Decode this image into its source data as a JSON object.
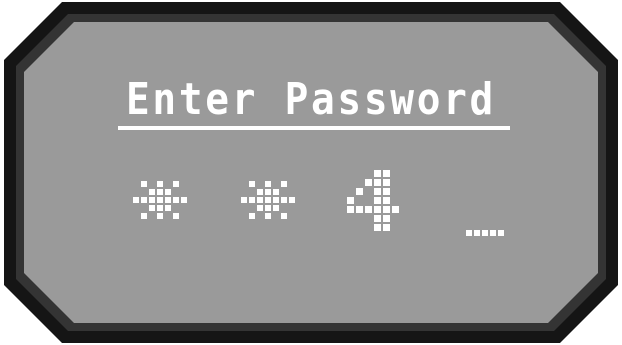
{
  "display": {
    "title": "Enter Password",
    "password_slots": [
      {
        "kind": "mask",
        "char": "*"
      },
      {
        "kind": "mask",
        "char": "*"
      },
      {
        "kind": "digit",
        "char": "4"
      },
      {
        "kind": "cursor",
        "char": "_"
      }
    ]
  },
  "colors": {
    "bezel_outer": "#151515",
    "bezel_rim": "#343434",
    "screen": "#9a9a9a",
    "pixel": "#ffffff"
  }
}
